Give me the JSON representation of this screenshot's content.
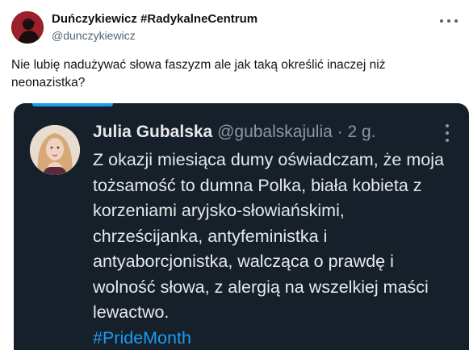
{
  "tweet": {
    "display_name": "Duńczykiewicz #RadykalneCentrum",
    "handle": "@dunczykiewicz",
    "text": "Nie lubię nadużywać słowa faszyzm ale jak taką określić inaczej niż neonazistka?",
    "avatar_icon": "profile-picture",
    "more_icon": "more-horizontal-icon"
  },
  "embedded": {
    "name": "Julia Gubalska",
    "handle": "@gubalskajulia",
    "separator": "·",
    "time": "2 g.",
    "text": "Z okazji miesiąca dumy oświadczam, że moja tożsamość to dumna Polka, biała kobieta z korzeniami aryjsko-słowiańskimi, chrześcijanka, antyfeministka i antyaborcjonistka, walcząca o prawdę i wolność słowa, z alergią na wszelkiej maści lewactwo.",
    "hashtag": "#PrideMonth",
    "more_icon": "more-vertical-icon",
    "colors": {
      "background": "#15202b",
      "text": "#e7e9ea",
      "muted": "#8b98a5",
      "link": "#1d9bf0"
    }
  }
}
